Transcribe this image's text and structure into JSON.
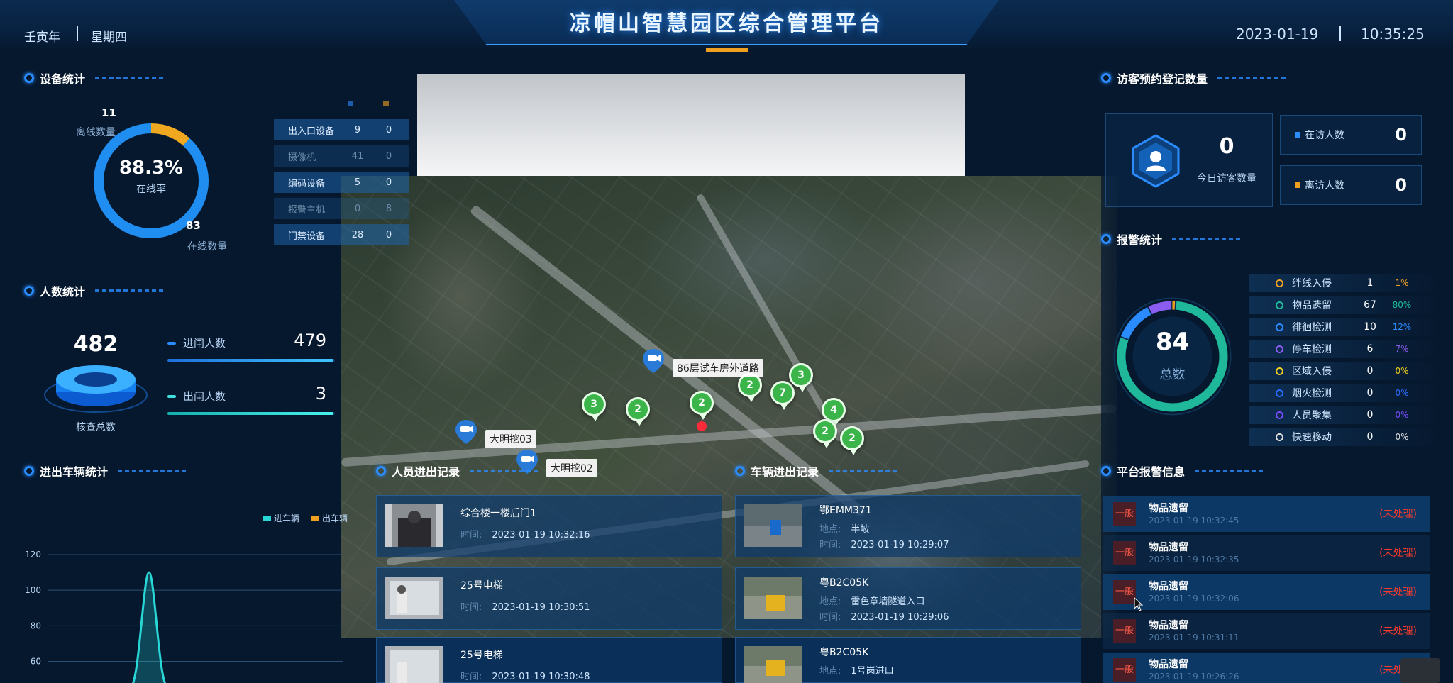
{
  "header": {
    "title": "凉帽山智慧园区综合管理平台",
    "year": "壬寅年",
    "weekday": "星期四",
    "date": "2023-01-19",
    "time": "10:35:25"
  },
  "device_stats": {
    "title": "设备统计",
    "online_rate": "88.3%",
    "online_rate_label": "在线率",
    "online_fraction": 0.883,
    "offline_count": "11",
    "offline_label": "离线数量",
    "online_count": "83",
    "online_label": "在线数量",
    "rows": [
      {
        "name": "出入口设备",
        "online": "9",
        "offline": "0",
        "faint": false
      },
      {
        "name": "摄像机",
        "online": "41",
        "offline": "0",
        "faint": true
      },
      {
        "name": "编码设备",
        "online": "5",
        "offline": "0",
        "faint": false
      },
      {
        "name": "报警主机",
        "online": "0",
        "offline": "8",
        "faint": true
      },
      {
        "name": "门禁设备",
        "online": "28",
        "offline": "0",
        "faint": false
      }
    ]
  },
  "people_stats": {
    "title": "人数统计",
    "total": "482",
    "total_label": "核查总数",
    "in_label": "进闸人数",
    "in_value": "479",
    "in_fraction": 0.99,
    "out_label": "出闸人数",
    "out_value": "3",
    "out_fraction": 0.99
  },
  "vehicle_stats": {
    "title": "进出车辆统计",
    "legend_in": "进车辆",
    "legend_out": "出车辆",
    "colors": {
      "in": "#29d6d6",
      "out": "#f0a020"
    }
  },
  "chart_data": {
    "type": "area",
    "yticks": [
      "120",
      "100",
      "80",
      "60"
    ],
    "ylim": [
      50,
      120
    ],
    "series": [
      {
        "name": "进车辆",
        "peak_value": 110
      }
    ]
  },
  "map": {
    "labels": {
      "road": "86层试车房外道路",
      "cam1": "大明挖03",
      "cam2": "大明挖02"
    },
    "clusters": [
      "3",
      "2",
      "2",
      "2",
      "7",
      "3",
      "4",
      "2",
      "2"
    ]
  },
  "person_records": {
    "title": "人员进出记录",
    "time_key": "时间:",
    "items": [
      {
        "place": "综合楼一楼后门1",
        "time": "2023-01-19 10:32:16"
      },
      {
        "place": "25号电梯",
        "time": "2023-01-19 10:30:51"
      },
      {
        "place": "25号电梯",
        "time": "2023-01-19 10:30:48"
      }
    ]
  },
  "vehicle_records": {
    "title": "车辆进出记录",
    "place_key": "地点:",
    "time_key": "时间:",
    "items": [
      {
        "plate": "鄂EMM371",
        "place": "半坡",
        "time": "2023-01-19 10:29:07"
      },
      {
        "plate": "粤B2C05K",
        "place": "雷色章墙隧道入口",
        "time": "2023-01-19 10:29:06"
      },
      {
        "plate": "粤B2C05K",
        "place": "1号岗进口",
        "time": ""
      }
    ]
  },
  "visitor_stats": {
    "title": "访客预约登记数量",
    "today_value": "0",
    "today_label": "今日访客数量",
    "present_label": "在访人数",
    "present_value": "0",
    "left_label": "离访人数",
    "left_value": "0",
    "colors": {
      "present": "#2a8cff",
      "left": "#f0a020"
    }
  },
  "alarm_stats": {
    "title": "报警统计",
    "total": "84",
    "total_label": "总数",
    "items": [
      {
        "name": "绊线入侵",
        "count": "1",
        "pct": "1%",
        "color": "#f0a020"
      },
      {
        "name": "物品遗留",
        "count": "67",
        "pct": "80%",
        "color": "#1fb89a"
      },
      {
        "name": "徘徊检测",
        "count": "10",
        "pct": "12%",
        "color": "#2a8cff"
      },
      {
        "name": "停车检测",
        "count": "6",
        "pct": "7%",
        "color": "#8a5cf0"
      },
      {
        "name": "区域入侵",
        "count": "0",
        "pct": "0%",
        "color": "#f0d020"
      },
      {
        "name": "烟火检测",
        "count": "0",
        "pct": "0%",
        "color": "#2a6cff"
      },
      {
        "name": "人员聚集",
        "count": "0",
        "pct": "0%",
        "color": "#7a4cff"
      },
      {
        "name": "快速移动",
        "count": "0",
        "pct": "0%",
        "color": "#e0e0e0"
      }
    ]
  },
  "platform_alarms": {
    "title": "平台报警信息",
    "items": [
      {
        "level": "一般",
        "type": "物品遗留",
        "time": "2023-01-19 10:32:45",
        "status": "(未处理)"
      },
      {
        "level": "一般",
        "type": "物品遗留",
        "time": "2023-01-19 10:32:35",
        "status": "(未处理)"
      },
      {
        "level": "一般",
        "type": "物品遗留",
        "time": "2023-01-19 10:32:06",
        "status": "(未处理)"
      },
      {
        "level": "一般",
        "type": "物品遗留",
        "time": "2023-01-19 10:31:11",
        "status": "(未处理)"
      },
      {
        "level": "一般",
        "type": "物品遗留",
        "time": "2023-01-19 10:26:26",
        "status": "(未处理)"
      }
    ]
  }
}
